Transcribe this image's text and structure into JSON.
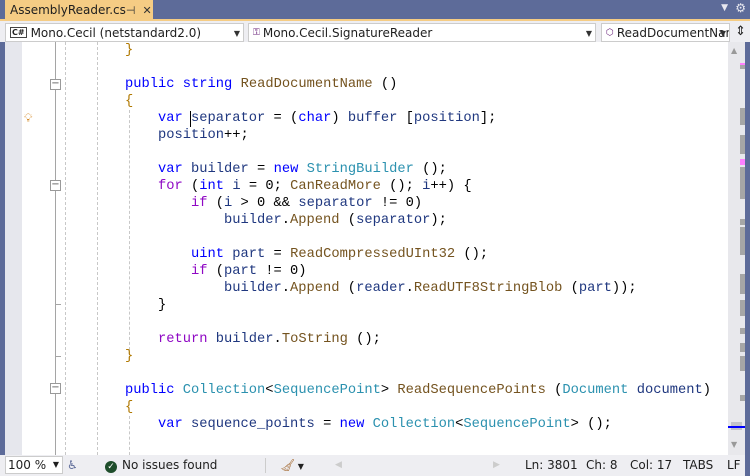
{
  "tab": {
    "title": "AssemblyReader.cs",
    "pin_icon": "pin-icon",
    "close_icon": "close-icon"
  },
  "navbar": {
    "project": "Mono.Cecil (netstandard2.0)",
    "type": "Mono.Cecil.SignatureReader",
    "member": "ReadDocumentName"
  },
  "code": {
    "lines": [
      {
        "indent": 0,
        "tokens": [
          [
            "}",
            "br"
          ]
        ]
      },
      {
        "indent": 0,
        "tokens": []
      },
      {
        "indent": 0,
        "tokens": [
          [
            "public",
            "kw"
          ],
          [
            " "
          ],
          [
            "string",
            "kw"
          ],
          [
            " "
          ],
          [
            "ReadDocumentName",
            "me"
          ],
          [
            " ()"
          ]
        ]
      },
      {
        "indent": 0,
        "tokens": [
          [
            "{",
            "br"
          ]
        ]
      },
      {
        "indent": 1,
        "tokens": [
          [
            "var",
            "kw"
          ],
          [
            " "
          ],
          [
            "separator",
            "va"
          ],
          [
            " = ("
          ],
          [
            "char",
            "kw"
          ],
          [
            ") "
          ],
          [
            "buffer",
            "va"
          ],
          [
            " ["
          ],
          [
            "position",
            "va"
          ],
          [
            "];"
          ]
        ]
      },
      {
        "indent": 1,
        "tokens": [
          [
            "position",
            "va"
          ],
          [
            "++;"
          ]
        ]
      },
      {
        "indent": 0,
        "tokens": []
      },
      {
        "indent": 1,
        "tokens": [
          [
            "var",
            "kw"
          ],
          [
            " "
          ],
          [
            "builder",
            "va"
          ],
          [
            " = "
          ],
          [
            "new",
            "kw"
          ],
          [
            " "
          ],
          [
            "StringBuilder",
            "ty"
          ],
          [
            " ();"
          ]
        ]
      },
      {
        "indent": 1,
        "tokens": [
          [
            "for",
            "ctl"
          ],
          [
            " ("
          ],
          [
            "int",
            "kw"
          ],
          [
            " "
          ],
          [
            "i",
            "va"
          ],
          [
            " = 0; "
          ],
          [
            "CanReadMore",
            "me"
          ],
          [
            " (); "
          ],
          [
            "i",
            "va"
          ],
          [
            "++) {"
          ]
        ]
      },
      {
        "indent": 2,
        "tokens": [
          [
            "if",
            "ctl"
          ],
          [
            " ("
          ],
          [
            "i",
            "va"
          ],
          [
            " > 0 && "
          ],
          [
            "separator",
            "va"
          ],
          [
            " != 0)"
          ]
        ]
      },
      {
        "indent": 3,
        "tokens": [
          [
            "builder",
            "va"
          ],
          [
            "."
          ],
          [
            "Append",
            "me"
          ],
          [
            " ("
          ],
          [
            "separator",
            "va"
          ],
          [
            ");"
          ]
        ]
      },
      {
        "indent": 0,
        "tokens": []
      },
      {
        "indent": 2,
        "tokens": [
          [
            "uint",
            "kw"
          ],
          [
            " "
          ],
          [
            "part",
            "va"
          ],
          [
            " = "
          ],
          [
            "ReadCompressedUInt32",
            "me"
          ],
          [
            " ();"
          ]
        ]
      },
      {
        "indent": 2,
        "tokens": [
          [
            "if",
            "ctl"
          ],
          [
            " ("
          ],
          [
            "part",
            "va"
          ],
          [
            " != 0)"
          ]
        ]
      },
      {
        "indent": 3,
        "tokens": [
          [
            "builder",
            "va"
          ],
          [
            "."
          ],
          [
            "Append",
            "me"
          ],
          [
            " ("
          ],
          [
            "reader",
            "va"
          ],
          [
            "."
          ],
          [
            "ReadUTF8StringBlob",
            "me"
          ],
          [
            " ("
          ],
          [
            "part",
            "va"
          ],
          [
            "));"
          ]
        ]
      },
      {
        "indent": 1,
        "tokens": [
          [
            "}"
          ]
        ]
      },
      {
        "indent": 0,
        "tokens": []
      },
      {
        "indent": 1,
        "tokens": [
          [
            "return",
            "ctl"
          ],
          [
            " "
          ],
          [
            "builder",
            "va"
          ],
          [
            "."
          ],
          [
            "ToString",
            "me"
          ],
          [
            " ();"
          ]
        ]
      },
      {
        "indent": 0,
        "tokens": [
          [
            "}",
            "br"
          ]
        ]
      },
      {
        "indent": 0,
        "tokens": []
      },
      {
        "indent": 0,
        "tokens": [
          [
            "public",
            "kw"
          ],
          [
            " "
          ],
          [
            "Collection",
            "ty"
          ],
          [
            "<"
          ],
          [
            "SequencePoint",
            "ty"
          ],
          [
            "> "
          ],
          [
            "ReadSequencePoints",
            "me"
          ],
          [
            " ("
          ],
          [
            "Document",
            "ty"
          ],
          [
            " "
          ],
          [
            "document",
            "va"
          ],
          [
            ")"
          ]
        ]
      },
      {
        "indent": 0,
        "tokens": [
          [
            "{",
            "br"
          ]
        ]
      },
      {
        "indent": 1,
        "tokens": [
          [
            "var",
            "kw"
          ],
          [
            " "
          ],
          [
            "sequence_points",
            "va"
          ],
          [
            " = "
          ],
          [
            "new",
            "kw"
          ],
          [
            " "
          ],
          [
            "Collection",
            "ty"
          ],
          [
            "<"
          ],
          [
            "SequencePoint",
            "ty"
          ],
          [
            "> ();"
          ]
        ]
      }
    ]
  },
  "status": {
    "zoom": "100 %",
    "issues": "No issues found",
    "ln": "Ln: 3801",
    "ch": "Ch: 8",
    "col": "Col: 17",
    "tabs": "TABS",
    "eol": "LF"
  },
  "colors": {
    "accent": "#f5cc84",
    "frame": "#5d6b99",
    "keyword": "#0000ff",
    "control": "#8f08c4",
    "type": "#2b91af",
    "method": "#74531f"
  }
}
